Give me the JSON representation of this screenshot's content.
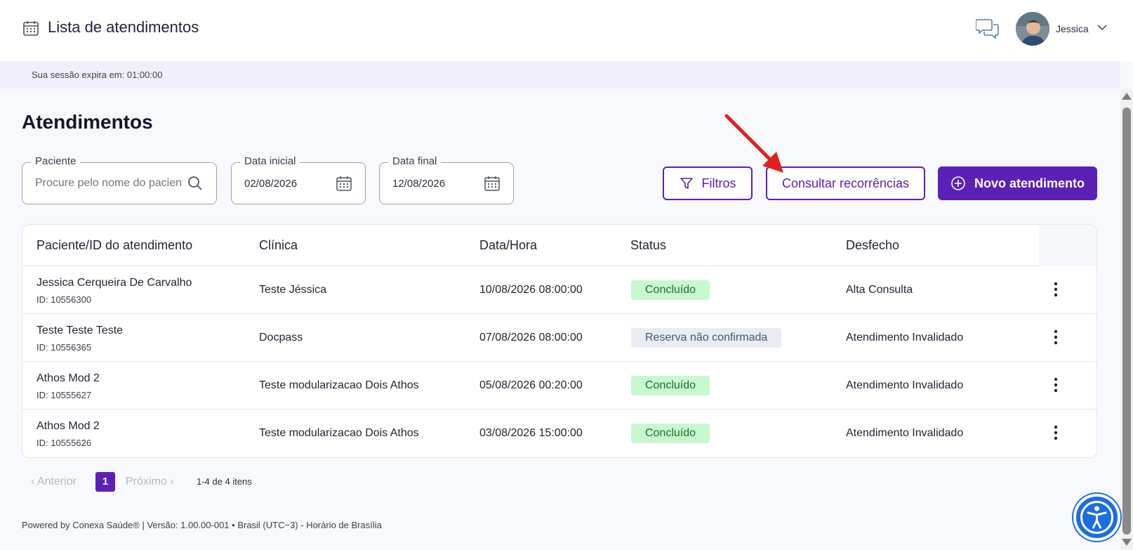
{
  "header": {
    "title": "Lista de atendimentos",
    "username": "Jessica",
    "icons": [
      "calendar-icon",
      "chat-icon",
      "chevron-down-icon"
    ]
  },
  "session": {
    "text": "Sua sessão expira em: 01:00:00"
  },
  "page": {
    "title": "Atendimentos"
  },
  "filters": {
    "patient": {
      "legend": "Paciente",
      "placeholder": "Procure pelo nome do paciente"
    },
    "start_date": {
      "legend": "Data inicial",
      "value": "02/08/2026"
    },
    "end_date": {
      "legend": "Data final",
      "value": "12/08/2026"
    }
  },
  "actions": {
    "filters_label": "Filtros",
    "recurrences_label": "Consultar recorrências",
    "new_label": "Novo atendimento"
  },
  "table": {
    "headers": [
      "Paciente/ID do atendimento",
      "Clínica",
      "Data/Hora",
      "Status",
      "Desfecho"
    ],
    "rows": [
      {
        "name": "Jessica Cerqueira De Carvalho",
        "id": "ID: 10556300",
        "clinic": "Teste Jéssica",
        "datetime": "10/08/2026 08:00:00",
        "status": "Concluído",
        "outcome": "Alta Consulta"
      },
      {
        "name": "Teste Teste Teste",
        "id": "ID: 10556365",
        "clinic": "Docpass",
        "datetime": "07/08/2026 08:00:00",
        "status": "Reserva não confirmada",
        "outcome": "Atendimento Invalidado"
      },
      {
        "name": "Athos Mod 2",
        "id": "ID: 10555627",
        "clinic": "Teste modularizacao Dois Athos",
        "datetime": "05/08/2026 00:20:00",
        "status": "Concluído",
        "outcome": "Atendimento Invalidado"
      },
      {
        "name": "Athos Mod 2",
        "id": "ID: 10555626",
        "clinic": "Teste modularizacao Dois Athos",
        "datetime": "03/08/2026 15:00:00",
        "status": "Concluído",
        "outcome": "Atendimento Invalidado"
      }
    ]
  },
  "pagination": {
    "prev": "Anterior",
    "page": "1",
    "next": "Próximo",
    "info": "1-4 de 4 itens"
  },
  "footer": {
    "text": "Powered by Conexa Saúde® | Versão: 1.00.00-001 • Brasil (UTC−3) - Horário de Brasília"
  },
  "colors": {
    "primary": "#5b21b6",
    "success_bg": "#c9f7cf",
    "pending_bg": "#e9edf3",
    "a11y": "#1a6ee0",
    "arrow": "#e02020"
  }
}
